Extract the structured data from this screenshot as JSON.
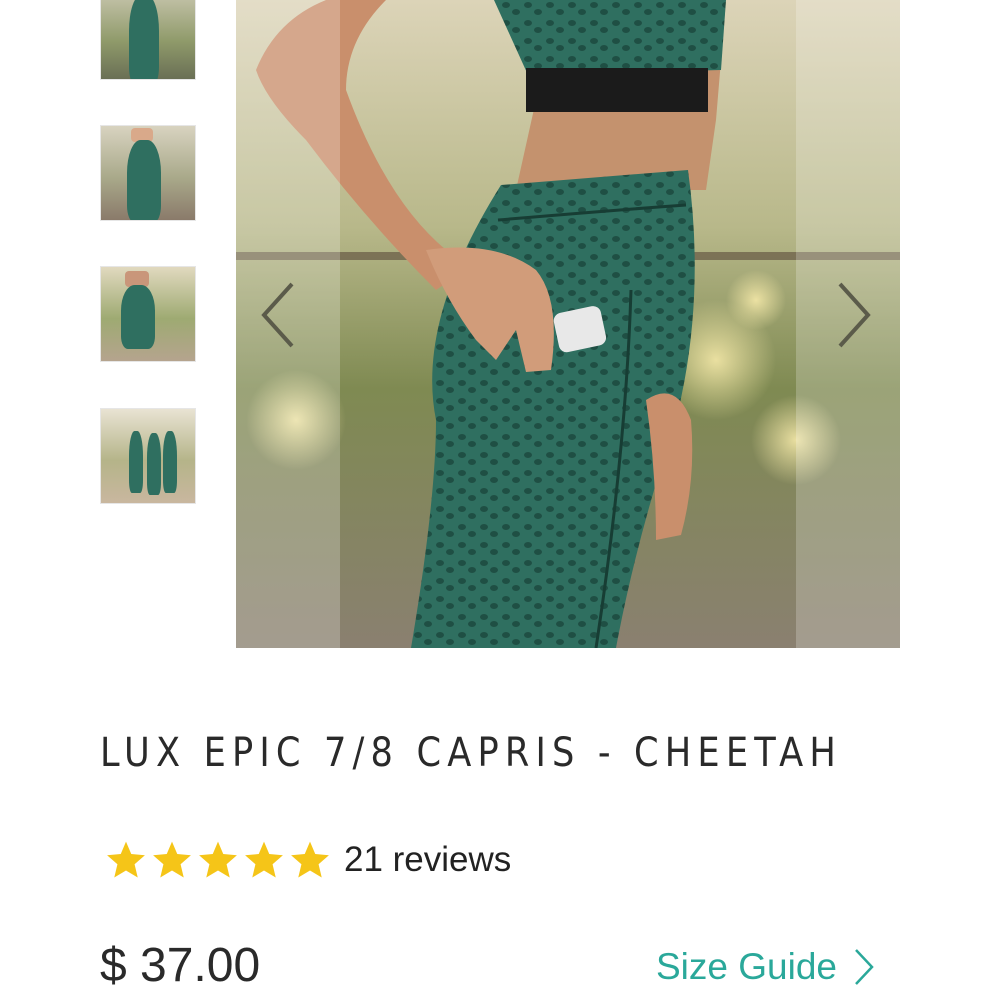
{
  "product": {
    "title": "LUX EPIC 7/8 CAPRIS - CHEETAH",
    "rating": {
      "stars": 5,
      "max": 5,
      "reviews_label": "21 reviews"
    },
    "price": "$ 37.00",
    "size_guide_label": "Size Guide"
  },
  "gallery": {
    "thumbnails": [
      "thumbnail-1",
      "thumbnail-2",
      "thumbnail-3",
      "thumbnail-4"
    ],
    "prev_icon": "chevron-left-icon",
    "next_icon": "chevron-right-icon"
  },
  "colors": {
    "star": "#f5c518",
    "link": "#2aa89a",
    "legging": "#2e6b5e"
  }
}
